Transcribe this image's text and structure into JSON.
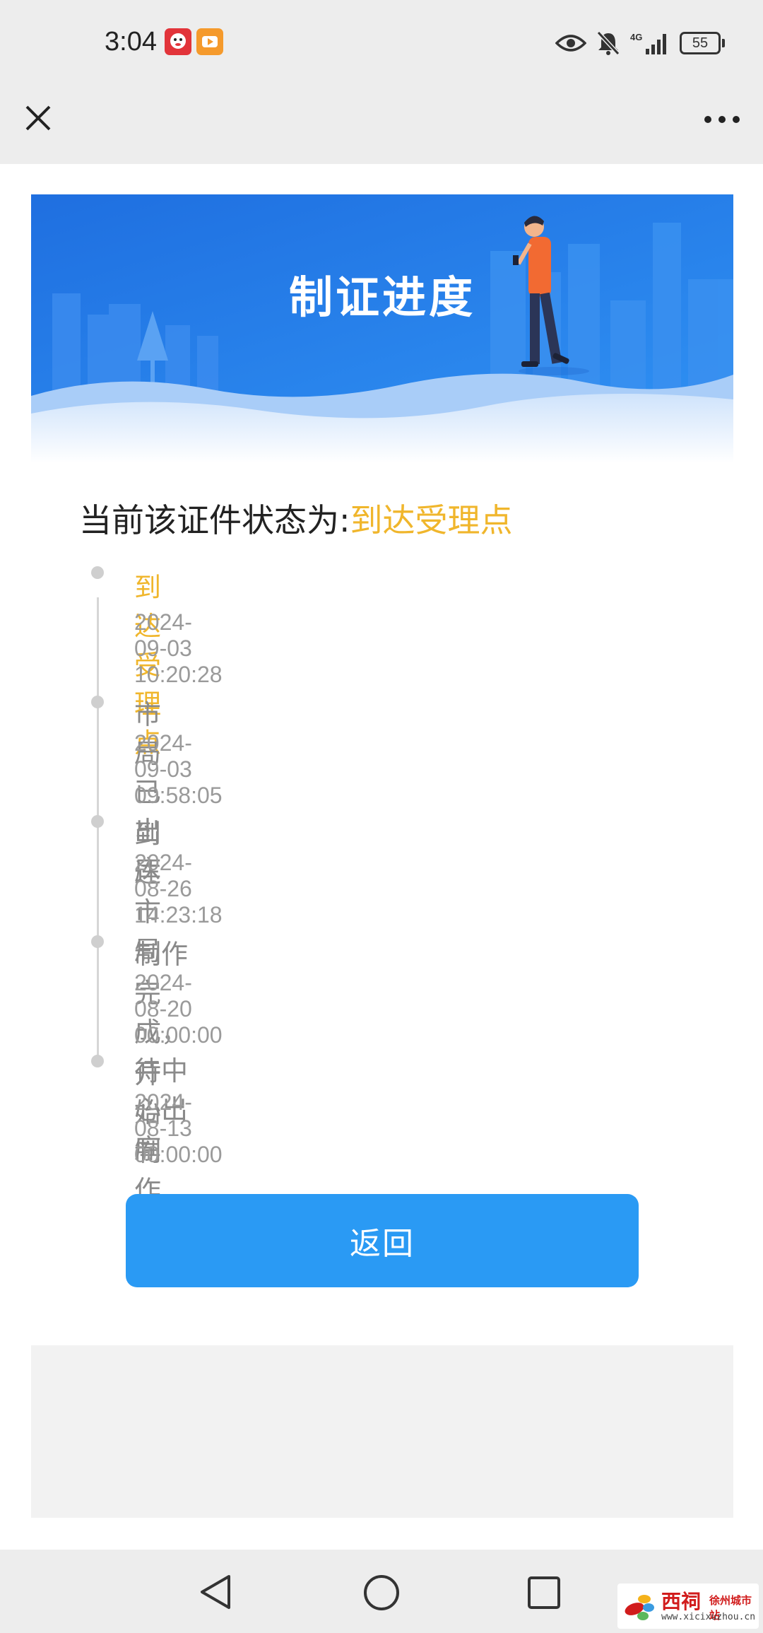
{
  "status_bar": {
    "time": "3:04",
    "network": "4G",
    "battery": "55",
    "icons": [
      "jd-app-icon",
      "video-app-icon",
      "eye-icon",
      "bell-muted-icon",
      "signal-icon",
      "battery-icon"
    ]
  },
  "top_bar": {
    "close_icon": "close-icon",
    "more_icon": "more-icon"
  },
  "banner": {
    "title": "制证进度"
  },
  "status": {
    "prefix": "当前该证件状态为:",
    "current": "到达受理点"
  },
  "timeline": [
    {
      "title": "到达受理点",
      "time": "2024-09-03 10:20:28",
      "active": true
    },
    {
      "title": "市局已出库",
      "time": "2024-09-03 09:58:05",
      "active": false
    },
    {
      "title": "到达市局",
      "time": "2024-08-26 14:23:18",
      "active": false
    },
    {
      "title": "制作完成，待中心出库",
      "time": "2024-08-20 00:00:00",
      "active": false
    },
    {
      "title": "开始制作",
      "time": "2024-08-13 00:00:00",
      "active": false
    }
  ],
  "back_button": {
    "label": "返回"
  },
  "colors": {
    "accent_blue": "#2a9af4",
    "highlight_yellow": "#f0b62c",
    "chrome_gray": "#ededed"
  },
  "watermark": {
    "brand": "西祠",
    "city": "徐州城市站",
    "url": "www.xicixuzhou.cn"
  }
}
